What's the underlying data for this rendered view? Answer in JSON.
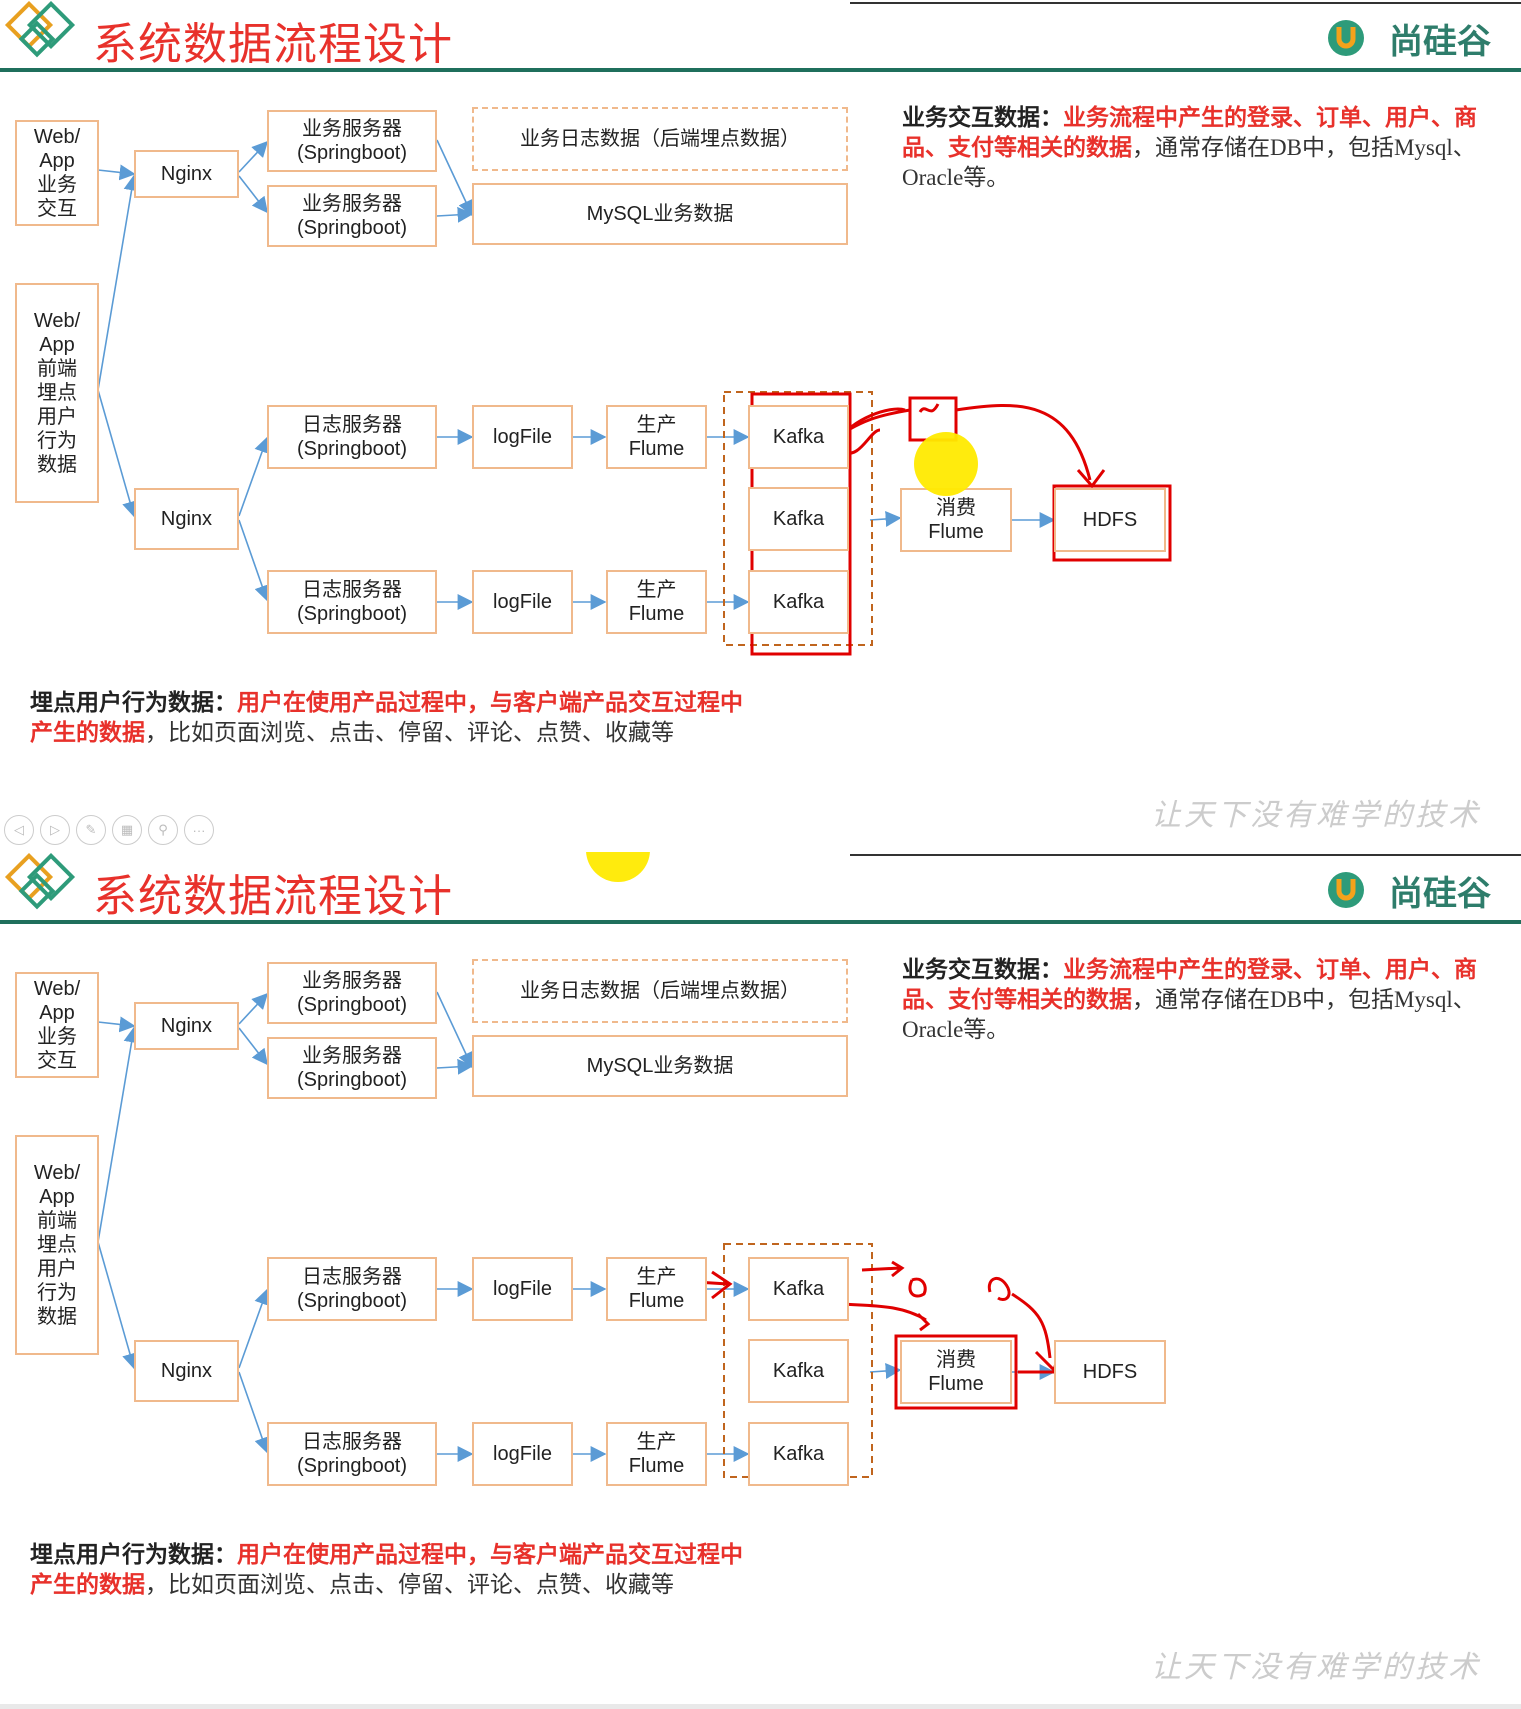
{
  "slide": {
    "title": "系统数据流程设计",
    "logo": "尚硅谷",
    "watermark": "让天下没有难学的技术",
    "boxes": {
      "web_app_business": "Web/\nApp\n业务\n交互",
      "web_app_frontend": "Web/\nApp\n前端\n埋点\n用户\n行为\n数据",
      "nginx": "Nginx",
      "biz_server": "业务服务器\n(Springboot)",
      "biz_log": "业务日志数据（后端埋点数据）",
      "mysql": "MySQL业务数据",
      "log_server": "日志服务器\n(Springboot)",
      "logfile": "logFile",
      "produce_flume": "生产\nFlume",
      "kafka": "Kafka",
      "consume_flume": "消费\nFlume",
      "hdfs": "HDFS"
    },
    "desc_business": {
      "label": "业务交互数据：",
      "highlight": "业务流程中产生的登录、订单、用户、商品、支付等相关的数据",
      "rest": "，通常存储在DB中，包括Mysql、Oracle等。"
    },
    "desc_behavior": {
      "label": "埋点用户行为数据：",
      "highlight": "用户在使用产品过程中，与客户端产品交互过程中产生的数据",
      "rest": "，比如页面浏览、点击、停留、评论、点赞、收藏等"
    }
  },
  "colors": {
    "title": "#e8312b",
    "box_border": "#f0b98c",
    "arrow": "#5b9bd5",
    "annotation": "#e00000",
    "logo": "#2e7d6b",
    "rule": "#1f6f5c"
  }
}
